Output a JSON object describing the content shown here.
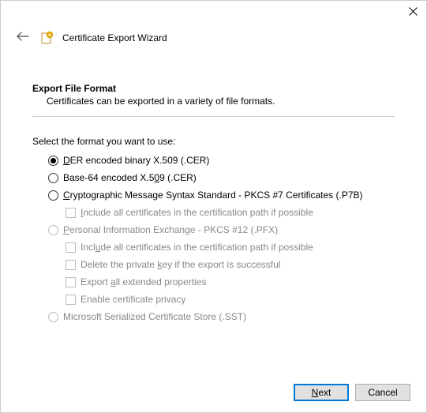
{
  "header": {
    "title": "Certificate Export Wizard"
  },
  "section": {
    "title": "Export File Format",
    "subtitle": "Certificates can be exported in a variety of file formats."
  },
  "prompt": "Select the format you want to use:",
  "options": {
    "der": {
      "pre": "",
      "u": "D",
      "post": "ER encoded binary X.509 (.CER)"
    },
    "base64": {
      "pre": "Base-64 encoded X.5",
      "u": "0",
      "post": "9 (.CER)"
    },
    "pkcs7": {
      "pre": "",
      "u": "C",
      "post": "ryptographic Message Syntax Standard - PKCS #7 Certificates (.P7B)"
    },
    "pkcs7_inc": {
      "pre": "",
      "u": "I",
      "post": "nclude all certificates in the certification path if possible"
    },
    "pfx": {
      "pre": "",
      "u": "P",
      "post": "ersonal Information Exchange - PKCS #12 (.PFX)"
    },
    "pfx_inc": {
      "pre": "Incl",
      "u": "u",
      "post": "de all certificates in the certification path if possible"
    },
    "pfx_del": {
      "pre": "Delete the private ",
      "u": "k",
      "post": "ey if the export is successful"
    },
    "pfx_ext": {
      "pre": "Export ",
      "u": "a",
      "post": "ll extended properties"
    },
    "pfx_priv": {
      "pre": "Enable certificate privacy",
      "u": "",
      "post": ""
    },
    "sst": {
      "pre": "Microsoft Serialized Certificate Store (.SST)",
      "u": "",
      "post": ""
    }
  },
  "footer": {
    "next_pre": "",
    "next_u": "N",
    "next_post": "ext",
    "cancel": "Cancel"
  }
}
